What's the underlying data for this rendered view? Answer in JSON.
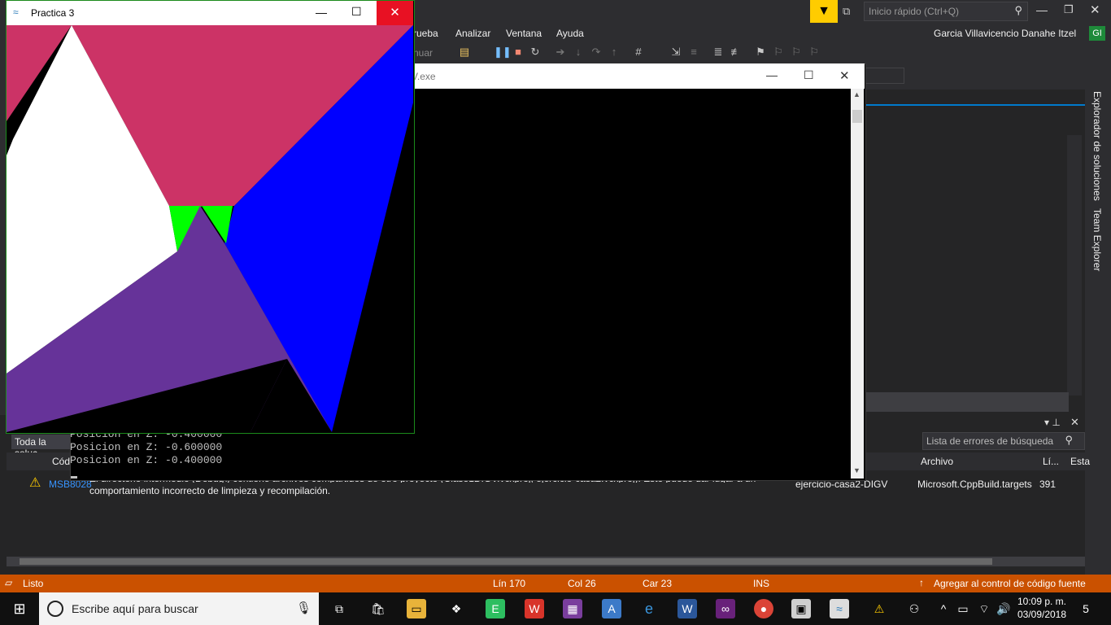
{
  "vs": {
    "quick_launch_placeholder": "Inicio rápido (Ctrl+Q)",
    "user_name": "Garcia Villavicencio Danahe Itzel",
    "user_initials": "GI",
    "menu": [
      "rueba",
      "Analizar",
      "Ventana",
      "Ayuda"
    ],
    "toolbar_continue": "nuar",
    "side_tabs": [
      "Explorador de soluciones",
      "Team Explorer"
    ]
  },
  "console_window": {
    "title": "V.exe",
    "lines": [
      "Posicion en Z: -0.400000",
      "Posicion en Z: -0.600000",
      "Posicion en Z: -0.400000"
    ]
  },
  "gl_window": {
    "title": "Practica 3",
    "colors": {
      "magenta": "#cc3366",
      "white": "#ffffff",
      "blue": "#0000ff",
      "green": "#00ff00",
      "purple": "#663399",
      "black": "#000000"
    }
  },
  "error_list": {
    "scope_label": "Toda la soluc",
    "search_placeholder": "Lista de errores de búsqueda",
    "columns": {
      "code": "Cód",
      "file": "Archivo",
      "line": "Lí...",
      "state": "Esta"
    },
    "rows": [
      {
        "code": "MSB8028",
        "description_line1": "El directorio intermedio (Debug\\) contiene archivos compartidos de otro proyecto (Clase1DIGV.vcxproj, ejercicio-casa2.vcxproj). Esto puede dar lugar a un",
        "description_line2": "comportamiento incorrecto de limpieza y recompilación.",
        "project": "ejercicio-casa2-DIGV",
        "file": "Microsoft.CppBuild.targets",
        "line": "391"
      }
    ]
  },
  "statusbar": {
    "ready": "Listo",
    "line": "Lín 170",
    "col": "Col 26",
    "car": "Car 23",
    "mode": "INS",
    "source_control": "Agregar al control de código fuente"
  },
  "taskbar": {
    "search_placeholder": "Escribe aquí para buscar",
    "time": "10:09 p. m.",
    "date": "03/09/2018",
    "notifications_count": "5"
  }
}
